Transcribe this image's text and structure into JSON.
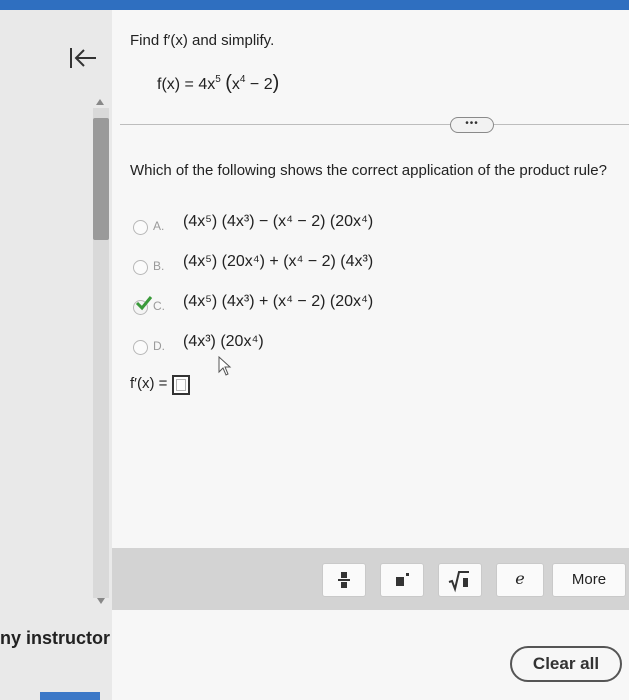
{
  "footer": {
    "instructor_label": "ny instructor",
    "clear_all_label": "Clear all"
  },
  "problem": {
    "prompt": "Find f′(x) and simplify.",
    "function_lhs": "f(x) = 4x",
    "function_exp": "5",
    "function_paren_open": "(",
    "function_inner": "x",
    "function_inner_exp": "4",
    "function_inner_rest": " − 2",
    "function_paren_close": ")"
  },
  "question": {
    "text": "Which of the following shows the correct application of the product rule?"
  },
  "options": [
    {
      "letter": "A.",
      "expr": "(4x⁵) (4x³) − (x⁴ − 2) (20x⁴)",
      "selected": false
    },
    {
      "letter": "B.",
      "expr": "(4x⁵) (20x⁴) + (x⁴ − 2) (4x³)",
      "selected": false
    },
    {
      "letter": "C.",
      "expr": "(4x⁵) (4x³) + (x⁴ − 2) (20x⁴)",
      "selected": true
    },
    {
      "letter": "D.",
      "expr": "(4x³) (20x⁴)",
      "selected": false
    }
  ],
  "answer": {
    "label": "f′(x) =",
    "value": ""
  },
  "toolbar": {
    "more_label": "More",
    "e_label": "e"
  },
  "colors": {
    "accent_blue": "#2f6fc0",
    "check_green": "#3a9a3a"
  },
  "icons": {
    "back": "back-to-start-icon",
    "fraction": "fraction-icon",
    "exponent": "exponent-icon",
    "sqrt": "square-root-icon",
    "check": "check-icon",
    "cursor": "mouse-cursor-icon"
  }
}
